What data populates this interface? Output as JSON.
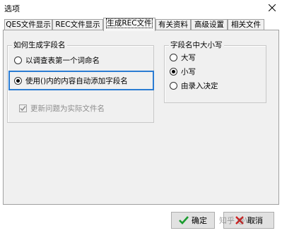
{
  "window": {
    "title": "选项",
    "close_icon": "close-icon"
  },
  "tabs": [
    {
      "label": "QES文件显示"
    },
    {
      "label": "REC文件显示"
    },
    {
      "label": "生成REC文件",
      "active": true
    },
    {
      "label": "有关资料"
    },
    {
      "label": "高级设置"
    },
    {
      "label": "相关文件"
    }
  ],
  "field_name_group": {
    "legend": "如何生成字段名",
    "options": [
      {
        "label": "以调查表第一个词命名",
        "selected": false
      },
      {
        "label": "使用()内的内容自动添加字段名",
        "selected": true
      }
    ],
    "checkbox": {
      "label": "更新问题为实际文件名",
      "checked": true,
      "disabled": true
    }
  },
  "case_group": {
    "legend": "字段名中大小写",
    "options": [
      {
        "label": "大写",
        "selected": false
      },
      {
        "label": "小写",
        "selected": true
      },
      {
        "label": "由录入决定",
        "selected": false
      }
    ]
  },
  "buttons": {
    "ok": "确定",
    "cancel": "取消"
  },
  "watermark": "知乎 @WPL",
  "colors": {
    "focus_border": "#2b7cd3",
    "ok_check": "#1a9c2f",
    "cancel_x": "#d31f1f"
  }
}
